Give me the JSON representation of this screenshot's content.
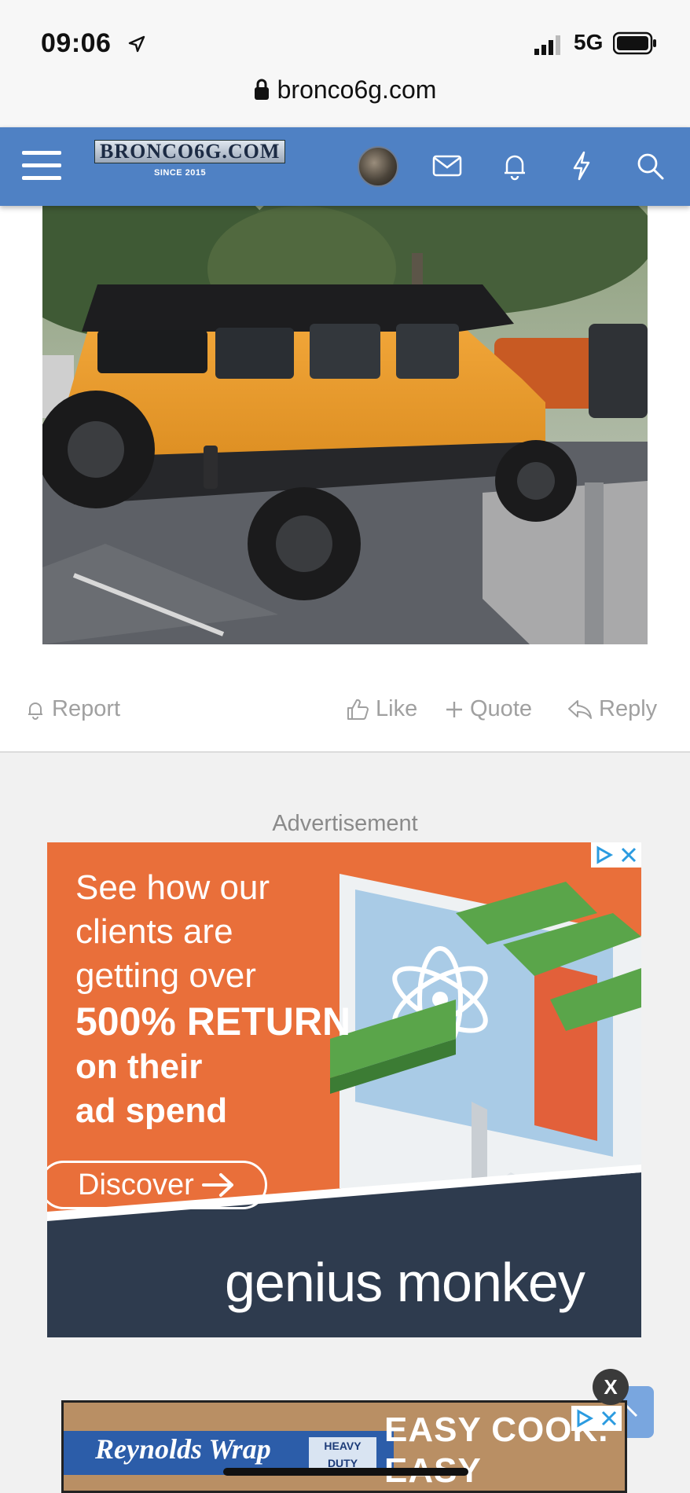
{
  "status_bar": {
    "time": "09:06",
    "network": "5G",
    "url": "bronco6g.com"
  },
  "site_header": {
    "logo_text": "BRONCO6G.COM",
    "logo_since": "SINCE 2015"
  },
  "icons": [
    "menu-icon",
    "avatar",
    "mail-icon",
    "bell-icon",
    "bolt-icon",
    "search-icon"
  ],
  "post_actions": {
    "report": "Report",
    "like": "Like",
    "quote": "Quote",
    "reply": "Reply"
  },
  "advertisement": {
    "label": "Advertisement",
    "lines": [
      "See how our",
      "clients are",
      "getting over"
    ],
    "headline": "500% RETURN",
    "sub_lines": [
      "on their",
      "ad spend"
    ],
    "cta": "Discover",
    "brand": "genius monkey"
  },
  "sticky_ad": {
    "close_label": "X",
    "brand": "Reynolds Wrap",
    "product": "HEAVY DUTY",
    "line1": "EASY COOK.",
    "line2": "EASY CLEAN."
  },
  "colors": {
    "header": "#4f81c4",
    "ad_orange": "#e96f3a",
    "ad_navy": "#2e3b4e"
  }
}
